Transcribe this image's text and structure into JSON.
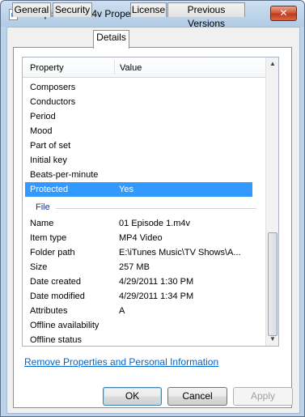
{
  "window": {
    "title": "01 Episode 1.m4v Properties",
    "close_glyph": "✕",
    "icon": "document-icon"
  },
  "tabs": [
    {
      "label": "General"
    },
    {
      "label": "Security"
    },
    {
      "label": "Details",
      "active": true
    },
    {
      "label": "License"
    },
    {
      "label": "Previous Versions"
    }
  ],
  "list": {
    "header_property": "Property",
    "header_value": "Value",
    "rows_top": [
      {
        "k": "Composers",
        "v": ""
      },
      {
        "k": "Conductors",
        "v": ""
      },
      {
        "k": "Period",
        "v": ""
      },
      {
        "k": "Mood",
        "v": ""
      },
      {
        "k": "Part of set",
        "v": ""
      },
      {
        "k": "Initial key",
        "v": ""
      },
      {
        "k": "Beats-per-minute",
        "v": ""
      }
    ],
    "selected_row": {
      "k": "Protected",
      "v": "Yes"
    },
    "group_file": "File",
    "rows_file": [
      {
        "k": "Name",
        "v": "01 Episode 1.m4v"
      },
      {
        "k": "Item type",
        "v": "MP4 Video"
      },
      {
        "k": "Folder path",
        "v": "E:\\iTunes Music\\TV Shows\\A..."
      },
      {
        "k": "Size",
        "v": "257 MB"
      },
      {
        "k": "Date created",
        "v": "4/29/2011 1:30 PM"
      },
      {
        "k": "Date modified",
        "v": "4/29/2011 1:34 PM"
      },
      {
        "k": "Attributes",
        "v": "A"
      },
      {
        "k": "Offline availability",
        "v": ""
      },
      {
        "k": "Offline status",
        "v": ""
      }
    ],
    "scroll_up_glyph": "▲",
    "scroll_down_glyph": "▼"
  },
  "link_text": "Remove Properties and Personal Information",
  "buttons": {
    "ok": "OK",
    "cancel": "Cancel",
    "apply": "Apply"
  },
  "colors": {
    "selection": "#3399ff",
    "link": "#0066cc",
    "group_label": "#1e3287"
  }
}
